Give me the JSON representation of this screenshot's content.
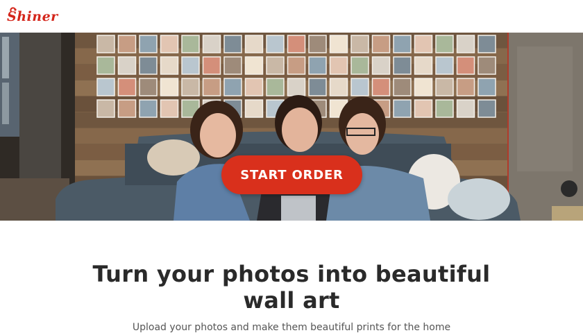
{
  "brand": {
    "logo_text": "Shiner",
    "accent_color": "#d9301c"
  },
  "hero": {
    "cta_label": "START ORDER"
  },
  "content": {
    "headline_line1": "Turn your photos into beautiful",
    "headline_line2": "wall art",
    "subtext": "Upload your photos and make them beautiful prints for the home"
  }
}
